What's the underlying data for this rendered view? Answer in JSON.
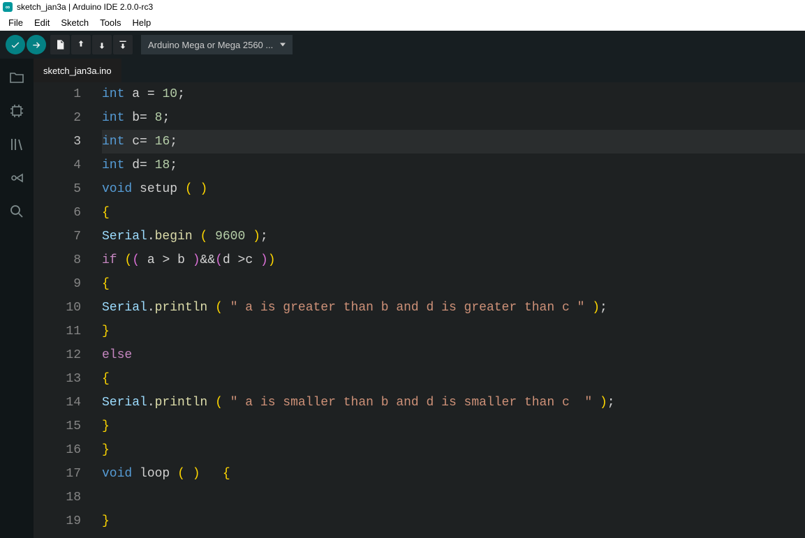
{
  "titlebar": {
    "text": "sketch_jan3a | Arduino IDE 2.0.0-rc3"
  },
  "menubar": {
    "items": [
      {
        "label": "File"
      },
      {
        "label": "Edit"
      },
      {
        "label": "Sketch"
      },
      {
        "label": "Tools"
      },
      {
        "label": "Help"
      }
    ]
  },
  "toolbar": {
    "board_label": "Arduino Mega or Mega 2560 ..."
  },
  "tabs": {
    "items": [
      {
        "label": "sketch_jan3a.ino"
      }
    ]
  },
  "editor": {
    "highlighted_line": 3,
    "lines": [
      {
        "n": "1",
        "tokens": [
          [
            "type",
            "int"
          ],
          [
            "op",
            " "
          ],
          [
            "var",
            "a"
          ],
          [
            "op",
            " "
          ],
          [
            "op",
            "="
          ],
          [
            "op",
            " "
          ],
          [
            "num",
            "10"
          ],
          [
            "op",
            ";"
          ]
        ]
      },
      {
        "n": "2",
        "tokens": [
          [
            "type",
            "int"
          ],
          [
            "op",
            " "
          ],
          [
            "var",
            "b"
          ],
          [
            "op",
            "= "
          ],
          [
            "num",
            "8"
          ],
          [
            "op",
            ";"
          ]
        ]
      },
      {
        "n": "3",
        "tokens": [
          [
            "type",
            "int"
          ],
          [
            "op",
            " "
          ],
          [
            "var",
            "c"
          ],
          [
            "op",
            "= "
          ],
          [
            "num",
            "16"
          ],
          [
            "op",
            ";"
          ]
        ]
      },
      {
        "n": "4",
        "tokens": [
          [
            "type",
            "int"
          ],
          [
            "op",
            " "
          ],
          [
            "var",
            "d"
          ],
          [
            "op",
            "= "
          ],
          [
            "num",
            "18"
          ],
          [
            "op",
            ";"
          ]
        ]
      },
      {
        "n": "5",
        "tokens": [
          [
            "type",
            "void"
          ],
          [
            "op",
            " "
          ],
          [
            "fn",
            "setup"
          ],
          [
            "op",
            " "
          ],
          [
            "br",
            "("
          ],
          [
            "op",
            " "
          ],
          [
            "br",
            ")"
          ]
        ]
      },
      {
        "n": "6",
        "tokens": [
          [
            "br",
            "{"
          ]
        ]
      },
      {
        "n": "7",
        "tokens": [
          [
            "obj",
            "Serial"
          ],
          [
            "op",
            "."
          ],
          [
            "call",
            "begin"
          ],
          [
            "op",
            " "
          ],
          [
            "br",
            "("
          ],
          [
            "op",
            " "
          ],
          [
            "num",
            "9600"
          ],
          [
            "op",
            " "
          ],
          [
            "br",
            ")"
          ],
          [
            "op",
            ";"
          ]
        ]
      },
      {
        "n": "8",
        "tokens": [
          [
            "kw",
            "if"
          ],
          [
            "op",
            " "
          ],
          [
            "br",
            "("
          ],
          [
            "br2",
            "("
          ],
          [
            "op",
            " "
          ],
          [
            "var",
            "a"
          ],
          [
            "op",
            " > "
          ],
          [
            "var",
            "b"
          ],
          [
            "op",
            " "
          ],
          [
            "br2",
            ")"
          ],
          [
            "op",
            "&&"
          ],
          [
            "br2",
            "("
          ],
          [
            "var",
            "d"
          ],
          [
            "op",
            " >"
          ],
          [
            "var",
            "c"
          ],
          [
            "op",
            " "
          ],
          [
            "br2",
            ")"
          ],
          [
            "br",
            ")"
          ]
        ]
      },
      {
        "n": "9",
        "tokens": [
          [
            "br",
            "{"
          ]
        ]
      },
      {
        "n": "10",
        "tokens": [
          [
            "obj",
            "Serial"
          ],
          [
            "op",
            "."
          ],
          [
            "call",
            "println"
          ],
          [
            "op",
            " "
          ],
          [
            "br",
            "("
          ],
          [
            "op",
            " "
          ],
          [
            "str",
            "\" a is greater than b and d is greater than c \""
          ],
          [
            "op",
            " "
          ],
          [
            "br",
            ")"
          ],
          [
            "op",
            ";"
          ]
        ]
      },
      {
        "n": "11",
        "tokens": [
          [
            "br",
            "}"
          ]
        ]
      },
      {
        "n": "12",
        "tokens": [
          [
            "kw",
            "else"
          ]
        ]
      },
      {
        "n": "13",
        "tokens": [
          [
            "br",
            "{"
          ]
        ]
      },
      {
        "n": "14",
        "tokens": [
          [
            "obj",
            "Serial"
          ],
          [
            "op",
            "."
          ],
          [
            "call",
            "println"
          ],
          [
            "op",
            " "
          ],
          [
            "br",
            "("
          ],
          [
            "op",
            " "
          ],
          [
            "str",
            "\" a is smaller than b and d is smaller than c  \""
          ],
          [
            "op",
            " "
          ],
          [
            "br",
            ")"
          ],
          [
            "op",
            ";"
          ]
        ]
      },
      {
        "n": "15",
        "tokens": [
          [
            "br",
            "}"
          ]
        ]
      },
      {
        "n": "16",
        "tokens": [
          [
            "br",
            "}"
          ]
        ]
      },
      {
        "n": "17",
        "tokens": [
          [
            "type",
            "void"
          ],
          [
            "op",
            " "
          ],
          [
            "fn",
            "loop"
          ],
          [
            "op",
            " "
          ],
          [
            "br",
            "("
          ],
          [
            "op",
            " "
          ],
          [
            "br",
            ")"
          ],
          [
            "op",
            "   "
          ],
          [
            "br",
            "{"
          ]
        ]
      },
      {
        "n": "18",
        "tokens": []
      },
      {
        "n": "19",
        "tokens": [
          [
            "br",
            "}"
          ]
        ]
      }
    ]
  }
}
